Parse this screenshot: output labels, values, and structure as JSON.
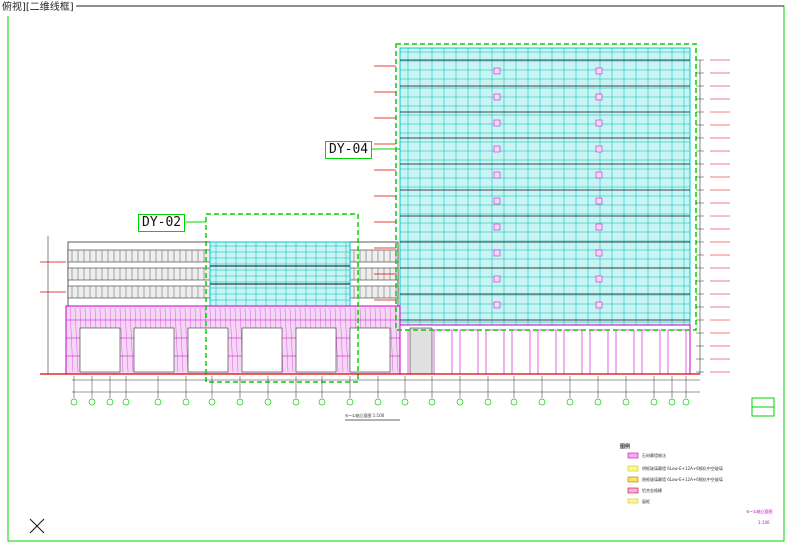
{
  "viewport": {
    "label": "俯视][二维线框]"
  },
  "callouts": {
    "dy02": "DY-02",
    "dy04": "DY-04"
  },
  "drawing": {
    "elevation_title": "⑥~①轴立面图 1:100",
    "sheet_title": "⑥~①轴立面图",
    "scale": "1:100"
  },
  "legend": {
    "title": "图例",
    "items": [
      "石材幕墙做法",
      "明框玻璃幕墙 6Low-E+12A+6钢化中空玻璃",
      "隐框玻璃幕墙 6Low-E+12A+6钢化中空玻璃",
      "铝合金格栅",
      "窗框"
    ]
  },
  "colors": {
    "outline": "#00d400",
    "glass": "#00c8c8",
    "stone": "#c800c8",
    "grid_red": "#e00000",
    "ink": "#111111"
  }
}
